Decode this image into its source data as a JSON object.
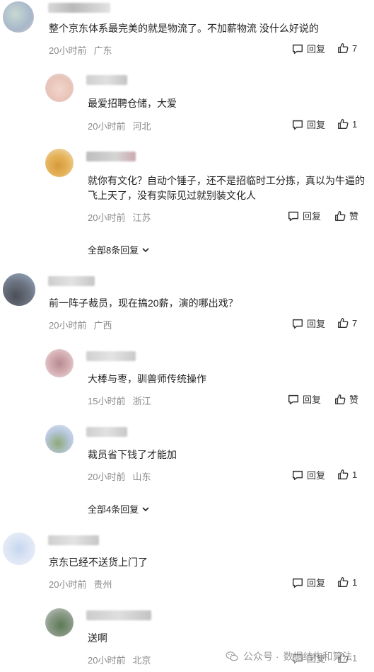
{
  "colors": {
    "meta": "#8a8a8a",
    "text": "#222222"
  },
  "icons": {
    "reply": "speech-bubble-icon",
    "like": "thumbs-up-icon",
    "expand": "chevron-down-icon",
    "watermark": "wechat-icon"
  },
  "comments": [
    {
      "text": "整个京东体系最完美的就是物流了。不加薪物流 没什么好说的",
      "time": "20小时前",
      "location": "广东",
      "reply_label": "回复",
      "like": "7"
    },
    {
      "text": "最爱招聘仓储，大爱",
      "time": "20小时前",
      "location": "河北",
      "reply_label": "回复",
      "like": "1"
    },
    {
      "text": "就你有文化？自动个锤子，还不是招临时工分拣，真以为牛逼的飞上天了，没有实际见过就别装文化人",
      "time": "20小时前",
      "location": "江苏",
      "reply_label": "回复",
      "like": "赞"
    },
    {
      "text": "前一阵子裁员，现在搞20薪，演的哪出戏？",
      "time": "20小时前",
      "location": "广西",
      "reply_label": "回复",
      "like": "7"
    },
    {
      "text": "大棒与枣，驯兽师传统操作",
      "time": "15小时前",
      "location": "浙江",
      "reply_label": "回复",
      "like": "赞"
    },
    {
      "text": "裁员省下钱了才能加",
      "time": "20小时前",
      "location": "山东",
      "reply_label": "回复",
      "like": "1"
    },
    {
      "text": "京东已经不送货上门了",
      "time": "20小时前",
      "location": "贵州",
      "reply_label": "回复",
      "like": "1"
    },
    {
      "text": "送啊",
      "time": "20小时前",
      "location": "北京",
      "reply_label": "回复",
      "like": "1"
    }
  ],
  "more_replies": [
    {
      "label": "全部8条回复"
    },
    {
      "label": "全部4条回复"
    }
  ],
  "watermark": {
    "prefix": "公众号 · ",
    "name": "数据结构和算法"
  }
}
